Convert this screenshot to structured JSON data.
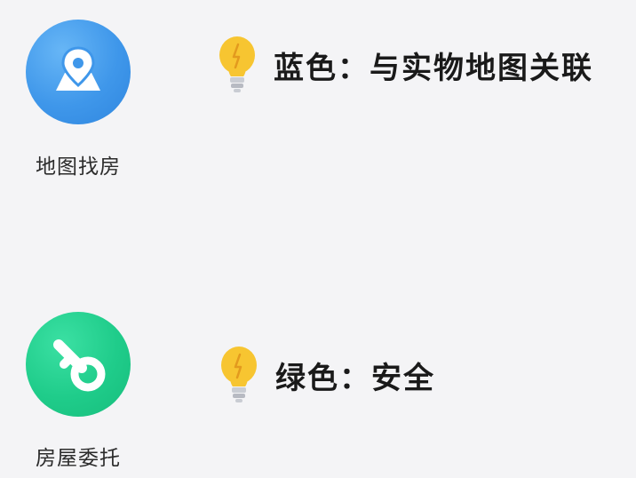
{
  "apps": [
    {
      "label": "地图找房",
      "icon": "map-pin-icon",
      "color": "#3f97ea"
    },
    {
      "label": "房屋委托",
      "icon": "key-icon",
      "color": "#1fcc8a"
    }
  ],
  "notes": [
    {
      "text": "蓝色：与实物地图关联",
      "icon": "lightbulb-icon"
    },
    {
      "text": "绿色：安全",
      "icon": "lightbulb-icon"
    }
  ],
  "colors": {
    "background": "#f4f4f6",
    "bulb": "#f7c531",
    "bulb_base": "#c9ccd3"
  }
}
